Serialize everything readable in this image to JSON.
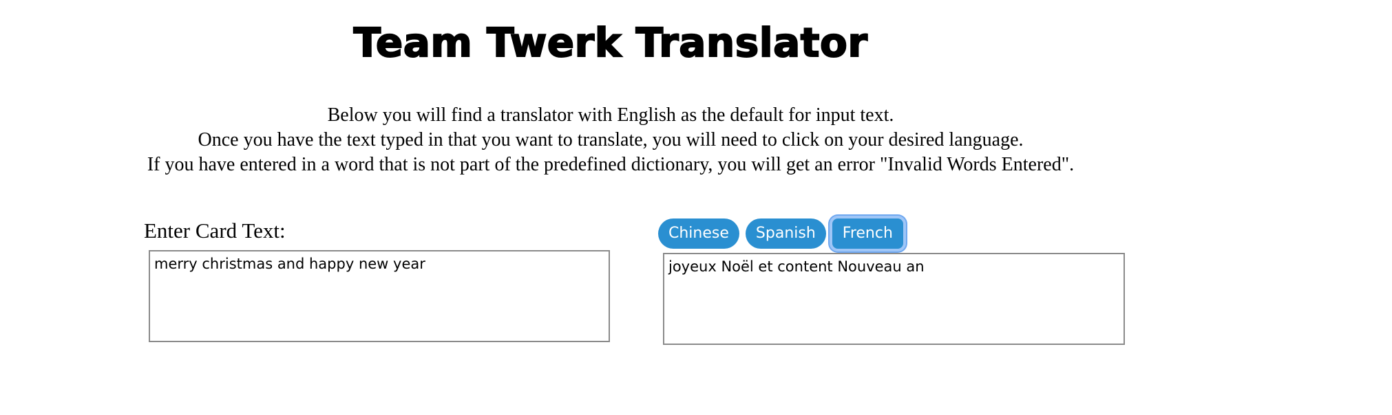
{
  "header": {
    "title": "Team Twerk Translator"
  },
  "instructions": {
    "line1": "Below you will find a translator with English as the default for input text.",
    "line2": "Once you have the text typed in that you want to translate, you will need to click on your desired language.",
    "line3": "If you have entered in a word that is not part of the predefined dictionary, you will get an error \"Invalid Words Entered\"."
  },
  "input": {
    "label": "Enter Card Text:",
    "value": "merry christmas and happy new year"
  },
  "languages": {
    "chinese": "Chinese",
    "spanish": "Spanish",
    "french": "French",
    "focused": "French"
  },
  "output": {
    "value": "joyeux Noël et content Nouveau an"
  },
  "colors": {
    "button_bg": "#2a8fd1",
    "button_text": "#ffffff",
    "focus_ring": "#6fa8f0"
  }
}
